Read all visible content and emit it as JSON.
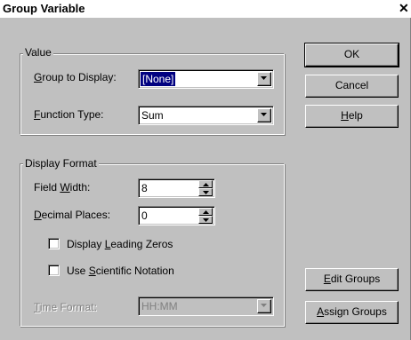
{
  "window": {
    "title": "Group Variable",
    "close_glyph": "✕"
  },
  "value_group": {
    "legend": "Value",
    "group_to_display": {
      "label_hotkey": "G",
      "label_rest": "roup to Display:",
      "value": "[None]"
    },
    "function_type": {
      "label_hotkey": "F",
      "label_rest": "unction Type:",
      "value": "Sum"
    }
  },
  "display_format": {
    "legend": "Display Format",
    "field_width": {
      "label_pre": "Field ",
      "label_hotkey": "W",
      "label_post": "idth:",
      "value": "8"
    },
    "decimal_places": {
      "label_hotkey": "D",
      "label_rest": "ecimal Places:",
      "value": "0"
    },
    "leading_zeros": {
      "label_pre": "Display ",
      "label_hotkey": "L",
      "label_post": "eading Zeros",
      "checked": false
    },
    "scientific_notation": {
      "label_pre": "Use ",
      "label_hotkey": "S",
      "label_post": "cientific Notation",
      "checked": false
    },
    "time_format": {
      "label_hotkey": "T",
      "label_rest": "ime Format:",
      "value": "HH:MM",
      "enabled": false
    }
  },
  "buttons": {
    "ok": "OK",
    "cancel": "Cancel",
    "help_hotkey": "H",
    "help_rest": "elp",
    "edit_groups_hotkey": "E",
    "edit_groups_rest": "dit Groups",
    "assign_groups_hotkey": "A",
    "assign_groups_rest": "ssign Groups"
  },
  "icons": {
    "dropdown": "chevron-down-icon",
    "spin_up": "arrow-up-icon",
    "spin_down": "arrow-down-icon",
    "close": "close-icon"
  },
  "colors": {
    "dialog_face": "#c0c0c0",
    "selection": "#000080",
    "disabled_text": "#808080"
  }
}
